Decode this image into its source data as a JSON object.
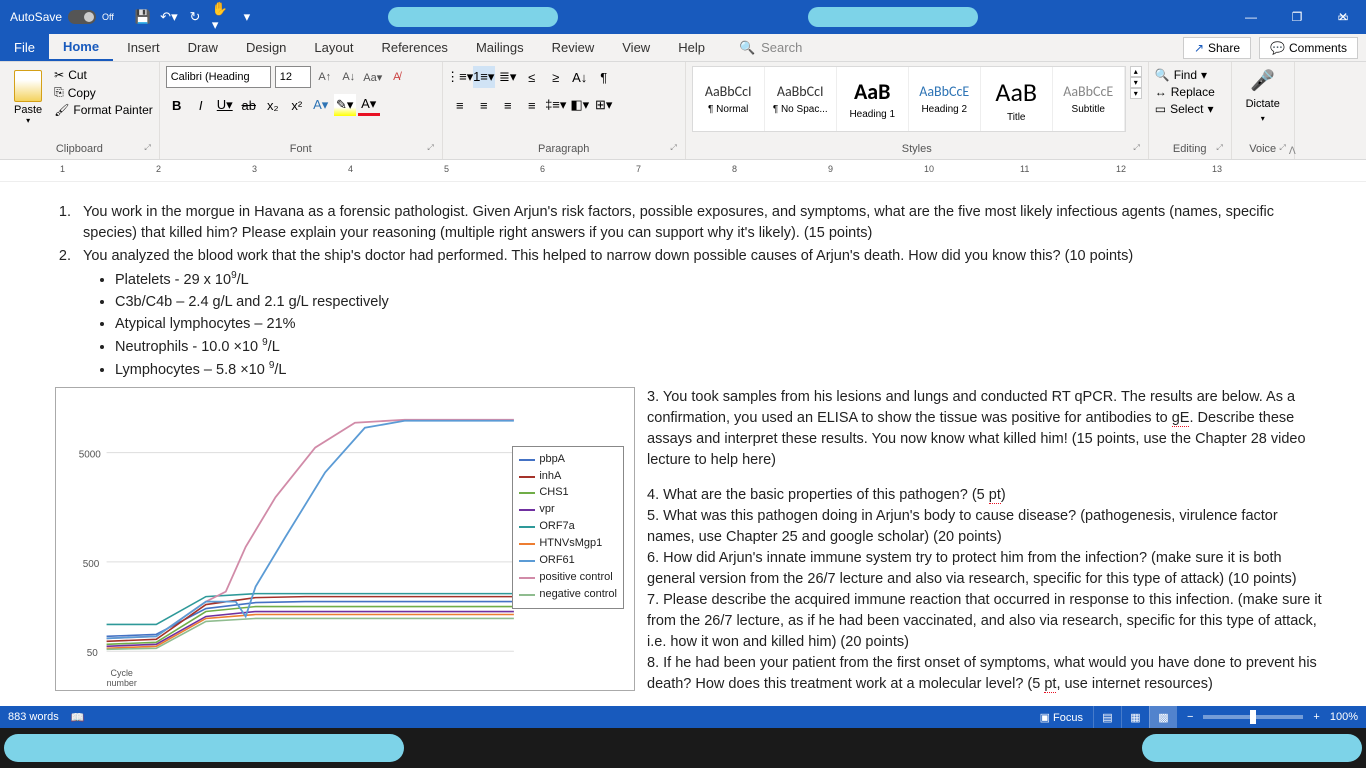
{
  "titlebar": {
    "autosave_label": "AutoSave",
    "autosave_state": "Off"
  },
  "tabs": {
    "file": "File",
    "home": "Home",
    "insert": "Insert",
    "draw": "Draw",
    "design": "Design",
    "layout": "Layout",
    "references": "References",
    "mailings": "Mailings",
    "review": "Review",
    "view": "View",
    "help": "Help",
    "search_placeholder": "Search"
  },
  "share": {
    "share": "Share",
    "comments": "Comments"
  },
  "clipboard": {
    "paste": "Paste",
    "cut": "Cut",
    "copy": "Copy",
    "format_painter": "Format Painter",
    "label": "Clipboard"
  },
  "font": {
    "name": "Calibri (Heading",
    "size": "12",
    "label": "Font"
  },
  "paragraph": {
    "label": "Paragraph"
  },
  "styles": {
    "label": "Styles",
    "items": [
      {
        "preview": "AaBbCcI",
        "name": "¶ Normal",
        "size": "14px",
        "weight": "400",
        "color": "#333"
      },
      {
        "preview": "AaBbCcI",
        "name": "¶ No Spac...",
        "size": "14px",
        "weight": "400",
        "color": "#333"
      },
      {
        "preview": "AaB",
        "name": "Heading 1",
        "size": "22px",
        "weight": "700",
        "color": "#000"
      },
      {
        "preview": "AaBbCcE",
        "name": "Heading 2",
        "size": "14px",
        "weight": "400",
        "color": "#2e74b5"
      },
      {
        "preview": "AaB",
        "name": "Title",
        "size": "26px",
        "weight": "400",
        "color": "#000"
      },
      {
        "preview": "AaBbCcE",
        "name": "Subtitle",
        "size": "14px",
        "weight": "400",
        "color": "#888"
      }
    ]
  },
  "editing": {
    "find": "Find",
    "replace": "Replace",
    "select": "Select",
    "label": "Editing"
  },
  "voice": {
    "dictate": "Dictate",
    "label": "Voice"
  },
  "ruler_marks": [
    "1",
    "2",
    "3",
    "4",
    "5",
    "6",
    "7",
    "8",
    "9",
    "10",
    "11",
    "12",
    "13"
  ],
  "document": {
    "q1": "You work in the morgue in Havana as a forensic pathologist.  Given Arjun's risk factors, possible exposures, and symptoms, what are the five most likely infectious agents (names, specific species) that killed him?  Please explain your reasoning (multiple right answers if you can support why it's likely). (15 points)",
    "q2": "You analyzed the blood work that the ship's doctor had performed.  This helped to narrow down possible causes of Arjun's death.  How did you know this? (10 points)",
    "b1_a": "Platelets - 29 x 10",
    "b1_b": "/L",
    "b2": "C3b/C4b – 2.4 g/L and 2.1 g/L respectively",
    "b3": "Atypical lymphocytes – 21%",
    "b4_a": "Neutrophils - 10.0 ×10 ",
    "b4_b": "/L",
    "b5_a": "Lymphocytes – 5.8 ×10 ",
    "b5_b": "/L",
    "q3_a": "3. You took samples from his lesions and lungs and conducted RT qPCR.  The results are below.  As a confirmation, you used an ELISA to show the tissue was positive for antibodies to ",
    "q3_gE": "gE",
    "q3_b": ".  Describe these assays and interpret these results.  You now know what killed him! (15 points, use the Chapter 28 video lecture to help here)",
    "q4_a": "4. What are the basic properties of this pathogen? (5 ",
    "q4_pt": "pt",
    "q4_b": ")",
    "q5": "5. What was this pathogen doing in Arjun's body to cause disease? (pathogenesis, virulence factor names, use Chapter 25 and google scholar) (20 points)",
    "q6": "6. How did Arjun's innate immune system try to protect him from the infection?  (make sure it is both general version from the 26/7 lecture and also via research, specific for this type of attack) (10 points)",
    "q7": "7. Please describe the acquired immune reaction that occurred in response to this infection. (make sure it from the 26/7 lecture, as if he had been vaccinated, and also via research, specific for this type of attack, i.e. how it won and killed him) (20 points)",
    "q8_a": "8. If he had been your patient from the first onset of symptoms, what would you have done to prevent his death? How does this treatment work at a molecular level? (5 ",
    "q8_pt": "pt",
    "q8_b": ", use internet resources)"
  },
  "chart_data": {
    "type": "line",
    "xlabel": "Cycle number",
    "ylabel": "",
    "y_ticks": [
      50,
      500,
      5000
    ],
    "y_scale": "log",
    "x_range": [
      0,
      40
    ],
    "series": [
      {
        "name": "pbpA",
        "color": "#4472c4"
      },
      {
        "name": "inhA",
        "color": "#a5332a"
      },
      {
        "name": "CHS1",
        "color": "#70ad47"
      },
      {
        "name": "vpr",
        "color": "#7030a0"
      },
      {
        "name": "ORF7a",
        "color": "#2e9999"
      },
      {
        "name": "HTNVsMgp1",
        "color": "#ed7d31"
      },
      {
        "name": "ORF61",
        "color": "#5b9bd5"
      },
      {
        "name": "positive control",
        "color": "#d18ba8"
      },
      {
        "name": "negative control",
        "color": "#8fbc8f"
      }
    ],
    "note": "Log-scale RT-qPCR amplification; positive control and ORF61 curves rise sharply to ~5000, others remain flat near baseline ~100-200."
  },
  "status": {
    "words": "883 words",
    "focus": "Focus",
    "zoom": "100%"
  }
}
